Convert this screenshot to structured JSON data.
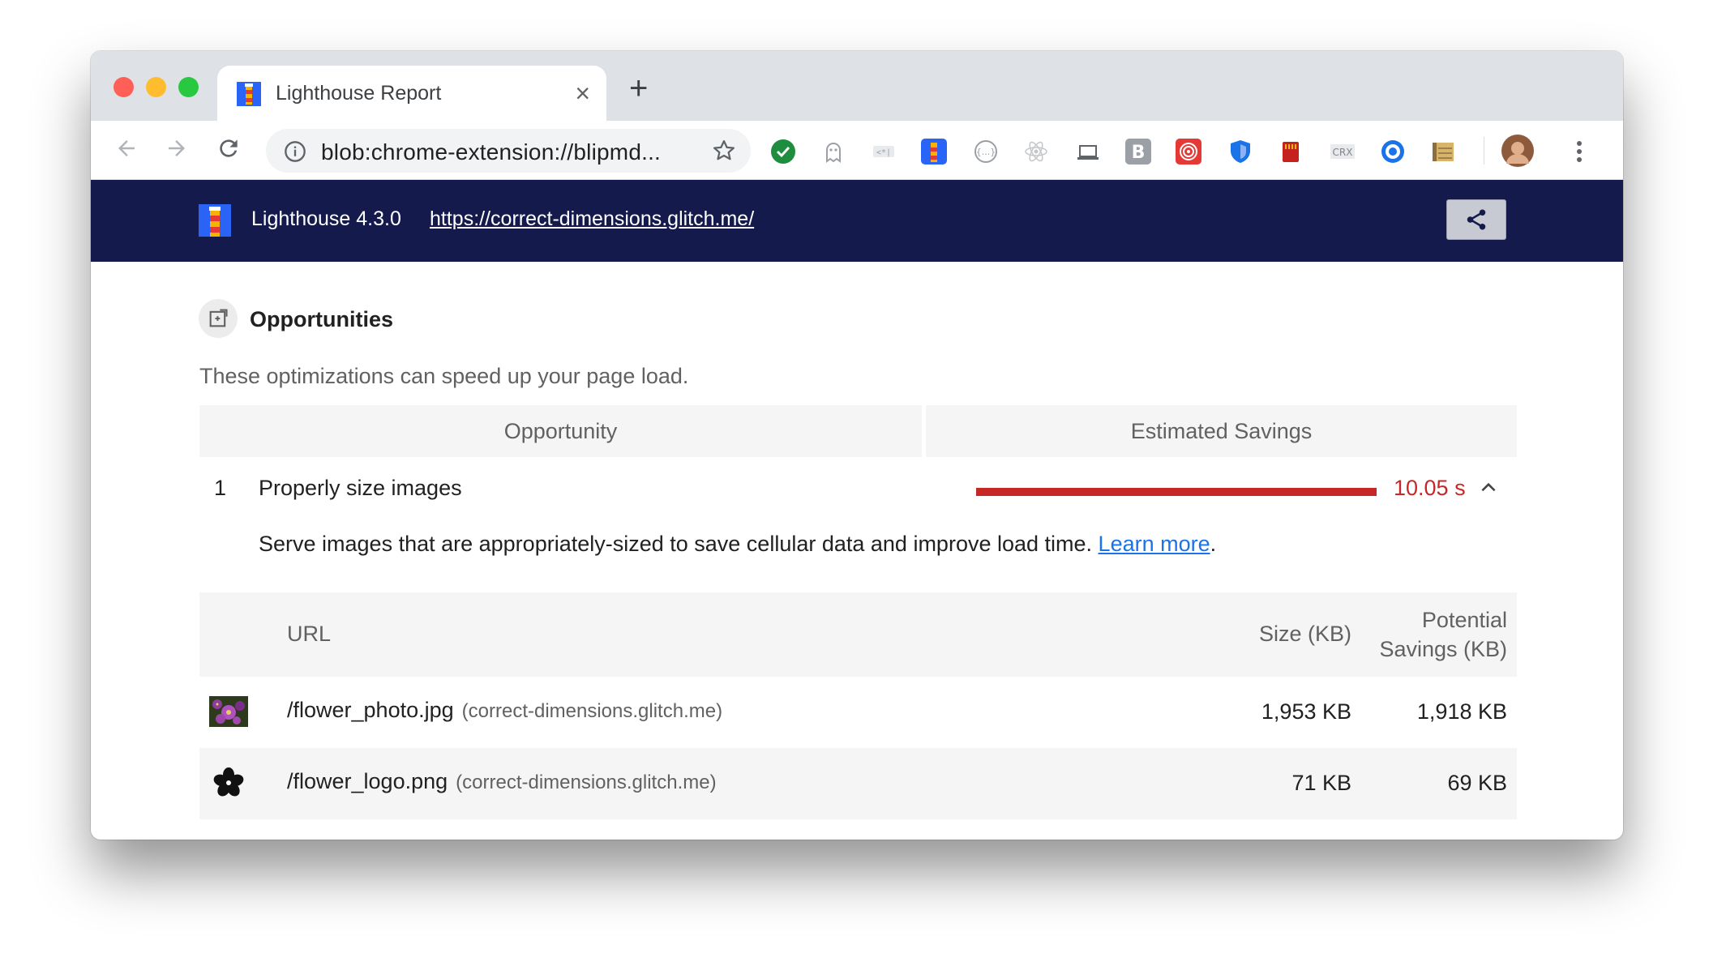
{
  "browser": {
    "tab_title": "Lighthouse Report",
    "url": "blob:chrome-extension://blipmd...",
    "extension_icons": [
      "check-icon",
      "ghost-icon",
      "code-icon",
      "lighthouse-icon",
      "braces-icon",
      "react-icon",
      "laptop-icon",
      "b-icon",
      "target-icon",
      "shield-icon",
      "sd-card-icon",
      "crx-icon",
      "vpn-icon",
      "notepad-icon"
    ]
  },
  "header": {
    "version": "Lighthouse 4.3.0",
    "url": "https://correct-dimensions.glitch.me/"
  },
  "section": {
    "title": "Opportunities",
    "description": "These optimizations can speed up your page load."
  },
  "table": {
    "col_opportunity": "Opportunity",
    "col_savings": "Estimated Savings"
  },
  "audit": {
    "number": "1",
    "title": "Properly size images",
    "savings": "10.05 s",
    "description": "Serve images that are appropriately-sized to save cellular data and improve load time. ",
    "learn_more": "Learn more",
    "period": "."
  },
  "details": {
    "col_url": "URL",
    "col_size": "Size (KB)",
    "col_potential_1": "Potential",
    "col_potential_2": "Savings (KB)",
    "rows": [
      {
        "file": "/flower_photo.jpg",
        "host": "(correct-dimensions.glitch.me)",
        "size": "1,953 KB",
        "savings": "1,918 KB"
      },
      {
        "file": "/flower_logo.png",
        "host": "(correct-dimensions.glitch.me)",
        "size": "71 KB",
        "savings": "69 KB"
      }
    ]
  },
  "colors": {
    "header_bg": "#141a4c",
    "fail": "#c62828",
    "link": "#1a73e8"
  }
}
